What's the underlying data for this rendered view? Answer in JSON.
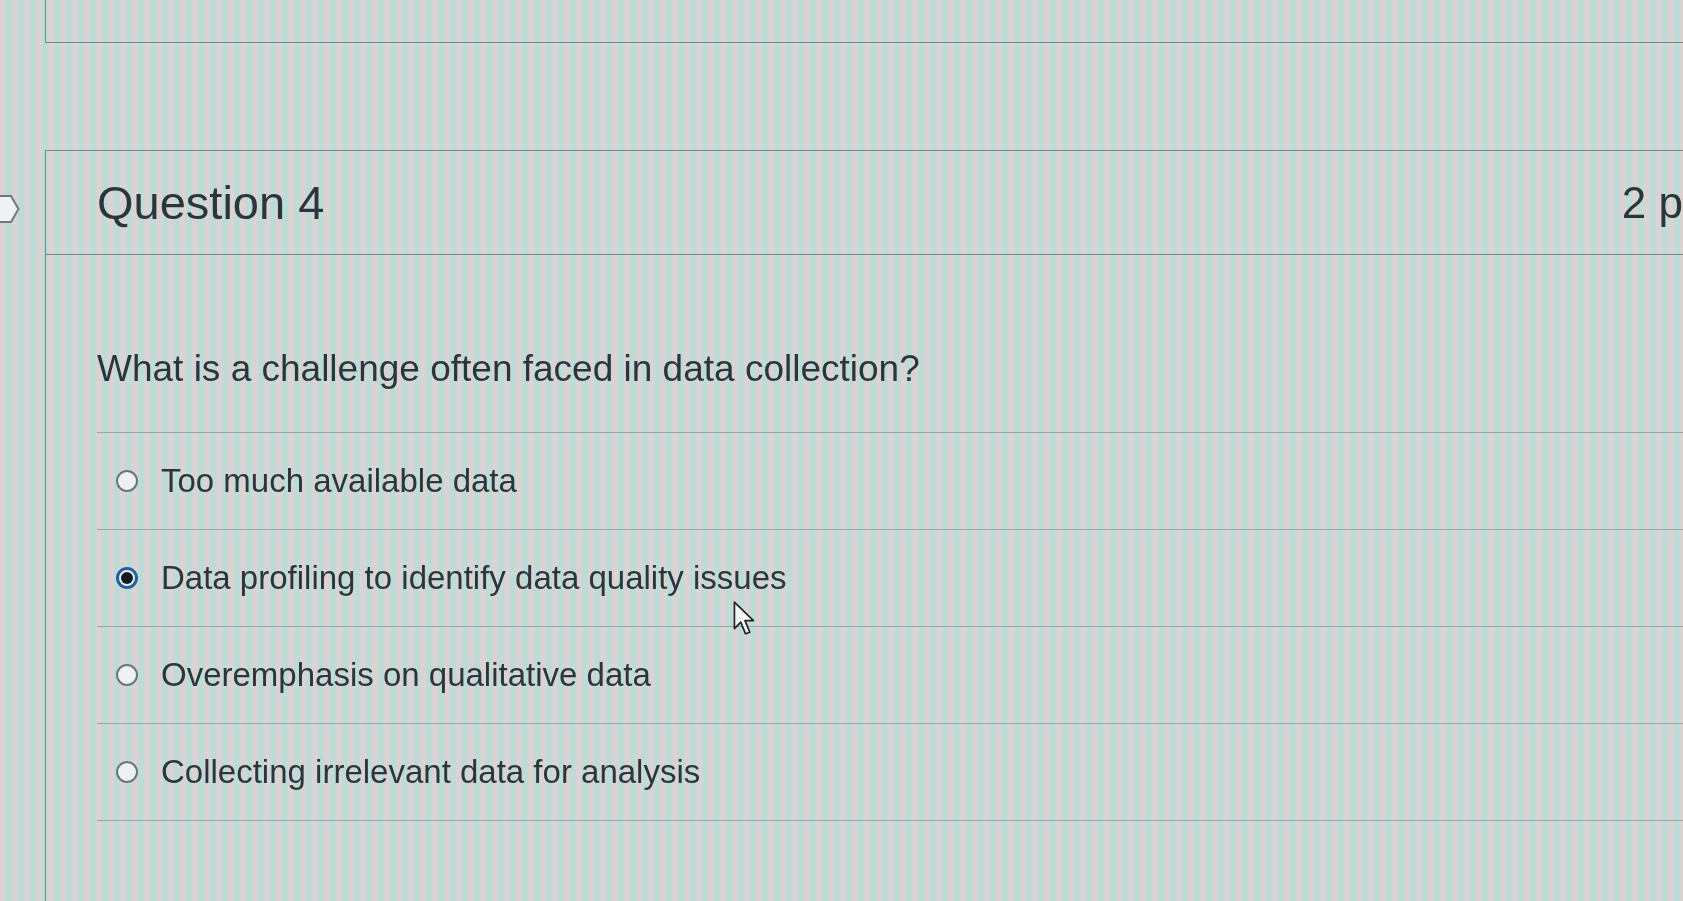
{
  "question": {
    "title": "Question 4",
    "points": "2 p",
    "prompt": "What is a challenge often faced in data collection?",
    "options": [
      {
        "label": "Too much available data",
        "selected": false
      },
      {
        "label": "Data profiling to identify data quality issues",
        "selected": true
      },
      {
        "label": "Overemphasis on qualitative data",
        "selected": false
      },
      {
        "label": "Collecting irrelevant data for analysis",
        "selected": false
      }
    ]
  }
}
